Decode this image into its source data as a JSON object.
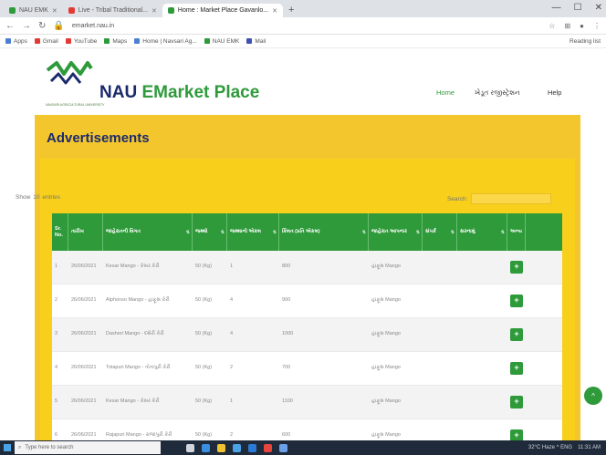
{
  "browser": {
    "tabs": [
      {
        "label": "NAU EMK",
        "fav": "#2e9a3a",
        "active": false
      },
      {
        "label": "Live - Tribal Traditional...",
        "fav": "#e53935",
        "active": false
      },
      {
        "label": "Home : Market Place Gavanlo...",
        "fav": "#2e9a3a",
        "active": true
      }
    ],
    "new_tab": "+",
    "window_controls": [
      "—",
      "☐",
      "✕"
    ],
    "url": "emarket.nau.in",
    "bookmarks": [
      {
        "label": "Apps",
        "fav": "#4a7fd4"
      },
      {
        "label": "Gmail",
        "fav": "#e53935"
      },
      {
        "label": "YouTube",
        "fav": "#e53935"
      },
      {
        "label": "Maps",
        "fav": "#2e9a3a"
      },
      {
        "label": "Home | Navsari Ag...",
        "fav": "#4a7fd4"
      },
      {
        "label": "NAU EMK",
        "fav": "#2e9a3a"
      },
      {
        "label": "Mail",
        "fav": "#3f51b5"
      }
    ],
    "bookmarks_right": "Reading list"
  },
  "site": {
    "title_part1": "NAU",
    "title_part2": "EMarket Place",
    "logo_caption": "NAVSARI AGRICULTURAL UNIVERSITY",
    "nav": {
      "home": "Home",
      "register": "ખેડૂત રજીસ્ટ્રેશન",
      "help": "Help"
    }
  },
  "page": {
    "heading": "Advertisements",
    "show_label": "Show",
    "show_value": "10",
    "entries_label": "entries",
    "search_label": "Search:"
  },
  "table": {
    "headers": [
      "Sr. No.",
      "તારીખ",
      "જાહેરાતની વિગત",
      "જથ્થો",
      "જથ્થાનો એકમ",
      "કિંમત (પ્રતિ એકમ)",
      "જાહેરાત આપનાર",
      "સંપર્ક",
      "સરનામું",
      "અન્ય"
    ],
    "rows": [
      [
        "1",
        "26/06/2021",
        "Kesar Mango - કેસર કેરી",
        "50 (Kg)",
        "1",
        "800",
        "હાફૂસ Mango",
        "",
        ""
      ],
      [
        "2",
        "26/06/2021",
        "Alphonso Mango - હાફૂસ કેરી",
        "50 (Kg)",
        "4",
        "900",
        "હાફૂસ Mango",
        "",
        ""
      ],
      [
        "3",
        "26/06/2021",
        "Dasheri Mango - દશેરી કેરી",
        "50 (Kg)",
        "4",
        "1000",
        "હાફૂસ Mango",
        "",
        ""
      ],
      [
        "4",
        "26/06/2021",
        "Totapuri Mango - તોતાપુરી કેરી",
        "50 (Kg)",
        "2",
        "700",
        "હાફૂસ Mango",
        "",
        ""
      ],
      [
        "5",
        "26/06/2021",
        "Kesar Mango - કેસર કેરી",
        "50 (Kg)",
        "1",
        "1100",
        "હાફૂસ Mango",
        "",
        ""
      ],
      [
        "6",
        "26/06/2021",
        "Rajapuri Mango - રાજાપુરી કેરી",
        "50 (Kg)",
        "2",
        "600",
        "હાફૂસ Mango",
        "",
        ""
      ]
    ],
    "action_icon": "+"
  },
  "fab_icon": "^",
  "taskbar": {
    "search_placeholder": "Type here to search",
    "status": "32°C  Haze  ^  ENG",
    "time": "11:31 AM"
  }
}
